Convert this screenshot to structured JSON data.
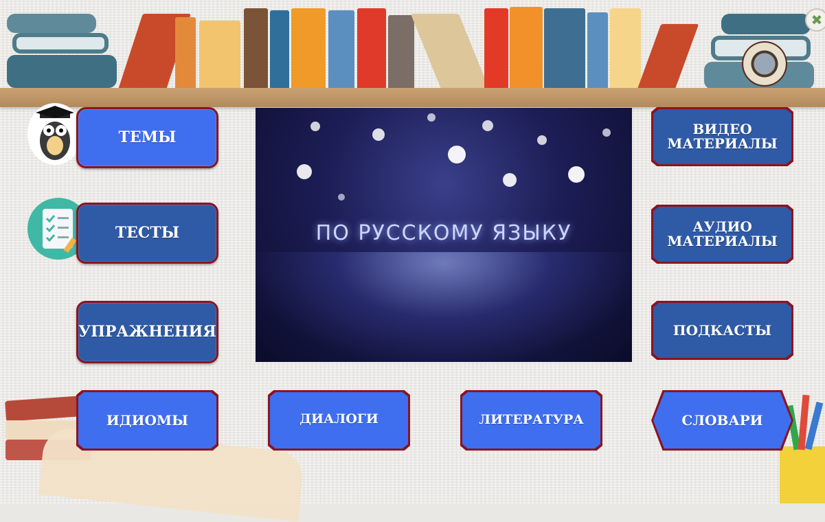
{
  "window": {
    "close_symbol": "✖"
  },
  "logo": {
    "icon": "emblem-seal-icon"
  },
  "video": {
    "title_text": "ПО РУССКОМУ ЯЗЫКУ"
  },
  "left_buttons": [
    {
      "label": "ТЕМЫ"
    },
    {
      "label": "ТЕСТЫ"
    },
    {
      "label": "УПРАЖНЕНИЯ"
    }
  ],
  "right_buttons": [
    {
      "label_line1": "ВИДЕО",
      "label_line2": "МАТЕРИАЛЫ"
    },
    {
      "label_line1": "АУДИО",
      "label_line2": "МАТЕРИАЛЫ"
    },
    {
      "label": "ПОДКАСТЫ"
    }
  ],
  "bottom_buttons": [
    {
      "label": "ИДИОМЫ"
    },
    {
      "label": "ДИАЛОГИ"
    },
    {
      "label": "ЛИТЕРАТУРА"
    },
    {
      "label": "СЛОВАРИ"
    }
  ],
  "colors": {
    "button_blue": "#3f6fef",
    "button_navy": "#2f5aa6",
    "button_border": "#8b1420",
    "shelf": "#c09465"
  }
}
